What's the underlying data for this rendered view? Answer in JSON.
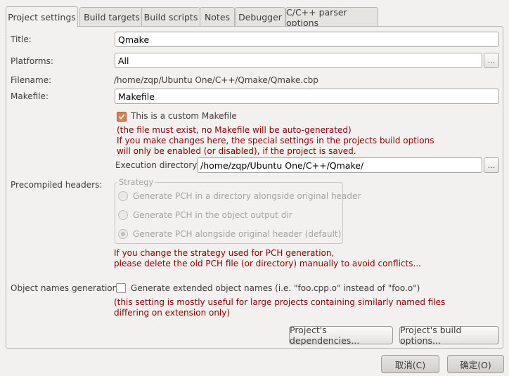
{
  "tabs": [
    "Project settings",
    "Build targets",
    "Build scripts",
    "Notes",
    "Debugger",
    "C/C++ parser options"
  ],
  "labels": {
    "title": "Title:",
    "platforms": "Platforms:",
    "filename": "Filename:",
    "makefile": "Makefile:",
    "precompiled": "Precompiled headers:",
    "object_names": "Object names generation:"
  },
  "fields": {
    "title": "Qmake",
    "platforms": "All",
    "filename": "/home/zqp/Ubuntu One/C++/Qmake/Qmake.cbp",
    "makefile": "Makefile",
    "exec_dir_label": "Execution directory:",
    "exec_dir": "/home/zqp/Ubuntu One/C++/Qmake/",
    "ellipsis": "..."
  },
  "custom_makefile": {
    "label": "This is a custom Makefile",
    "checked": true,
    "note1": "(the file must exist, no Makefile will be auto-generated)",
    "note2": "If you make changes here, the special settings in the projects build options",
    "note3": "will only be enabled (or disabled), if the project is saved."
  },
  "pch": {
    "group_title": "Strategy",
    "options": [
      "Generate PCH in a directory alongside original header",
      "Generate PCH in the object output dir",
      "Generate PCH alongside original header (default)"
    ],
    "selected": 2,
    "warn1": "If you change the strategy used for PCH generation,",
    "warn2": "please delete the old PCH file (or directory) manually to avoid conflicts..."
  },
  "object_names": {
    "checkbox_label": "Generate extended object names (i.e. \"foo.cpp.o\" instead of \"foo.o\")",
    "checked": false,
    "note1": "(this setting is mostly useful for large projects containing similarly named files",
    "note2": "differing on extension only)"
  },
  "buttons": {
    "dependencies": "Project's dependencies...",
    "build_options": "Project's build options...",
    "cancel": "取消(C)",
    "ok": "确定(O)"
  }
}
